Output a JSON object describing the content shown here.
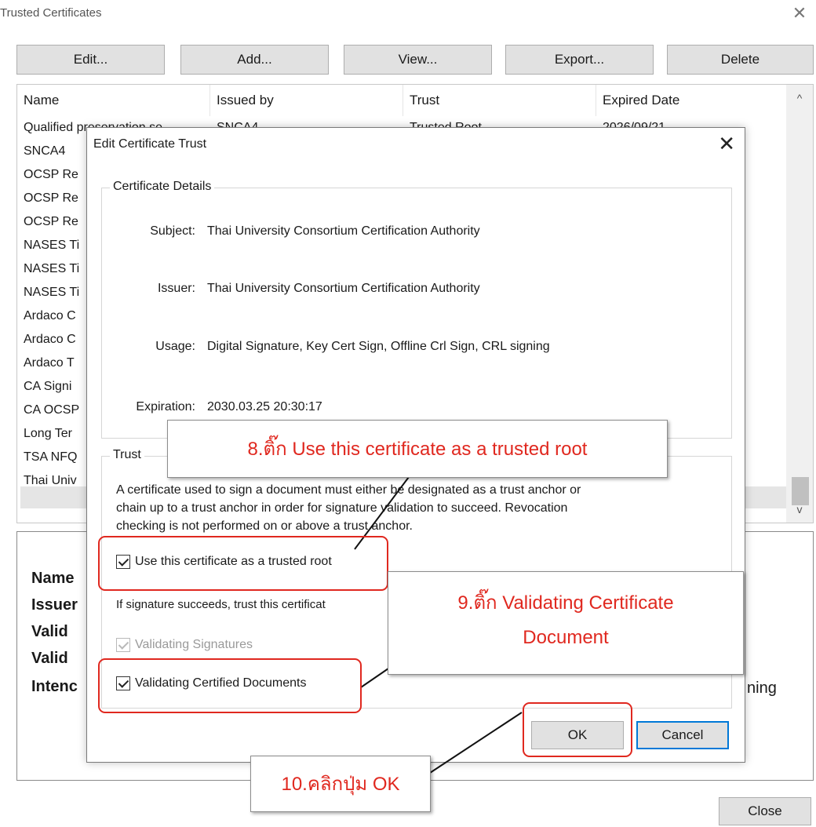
{
  "window": {
    "title": "Trusted Certificates",
    "close_glyph": "✕"
  },
  "toolbar": [
    "Edit...",
    "Add...",
    "View...",
    "Export...",
    "Delete"
  ],
  "list": {
    "columns": [
      "Name",
      "Issued by",
      "Trust",
      "Expired Date"
    ],
    "first_row": {
      "name": "Qualified preservation se",
      "issuer": "SNCA4",
      "trust": "Trusted Root",
      "expires": "2026/09/21"
    },
    "rows": [
      "SNCA4",
      "OCSP Re",
      "OCSP Re",
      "OCSP Re",
      "NASES Ti",
      "NASES Ti",
      "NASES Ti",
      "Ardaco C",
      "Ardaco C",
      "Ardaco T",
      "CA Signi",
      "CA OCSP",
      "Long Ter",
      "TSA NFQ",
      "Thai Univ"
    ],
    "scroll_up": "^",
    "scroll_down": "v"
  },
  "details": {
    "labels": [
      "Name",
      "Issuer",
      "Valid",
      "Valid",
      "Intenc"
    ],
    "trailing": "ning"
  },
  "close_button": "Close",
  "dialog": {
    "title": "Edit Certificate Trust",
    "close_glyph": "✕",
    "cert_details": {
      "legend": "Certificate Details",
      "subject_label": "Subject:",
      "subject": "Thai University Consortium Certification Authority",
      "issuer_label": "Issuer:",
      "issuer": "Thai University Consortium Certification Authority",
      "usage_label": "Usage:",
      "usage": "Digital Signature, Key Cert Sign, Offline Crl Sign, CRL signing",
      "expiration_label": "Expiration:",
      "expiration": "2030.03.25 20:30:17"
    },
    "trust": {
      "legend": "Trust",
      "description_1": "A certificate used to sign a document must either be designated as a trust anchor or",
      "description_2": "chain up to a trust anchor in order for signature validation to succeed. Revocation",
      "description_3": "checking is not performed on or above a trust anchor.",
      "use_root": "Use this certificate as a trusted root",
      "if_succeeds": "If signature succeeds, trust this certificat",
      "validating_signatures": "Validating Signatures",
      "validating_certified": "Validating Certified Documents"
    },
    "ok": "OK",
    "cancel": "Cancel"
  },
  "callouts": {
    "step8": "8.ติ๊ก Use this certificate as a trusted root",
    "step9_line1": "9.ติ๊ก Validating Certificate",
    "step9_line2": "Document",
    "step10": "10.คลิกปุ่ม OK"
  },
  "colors": {
    "annotation": "#e0281f",
    "ok_focus": "#0078d7"
  }
}
